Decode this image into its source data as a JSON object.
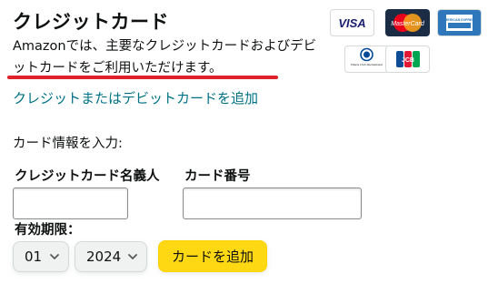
{
  "section": {
    "title": "クレジットカード",
    "description": "Amazonでは、主要なクレジットカードおよびデビットカードをご利用いただけます。",
    "add_link": "クレジットまたはデビットカードを追加"
  },
  "card_logos": [
    {
      "name": "VISA",
      "label": "VISA"
    },
    {
      "name": "MasterCard",
      "label": "MasterCard"
    },
    {
      "name": "American Express",
      "label": "AMERICAN EXPRESS"
    },
    {
      "name": "Diners Club International",
      "label": "Diners Club International"
    },
    {
      "name": "JCB",
      "label": "JCB"
    }
  ],
  "form": {
    "enter_label": "カード情報を入力:",
    "name_label": "クレジットカード名義人",
    "number_label": "カード番号",
    "expiry_label": "有効期限：",
    "name_value": "",
    "number_value": "",
    "month_value": "01",
    "year_value": "2024",
    "submit_label": "カードを追加"
  },
  "colors": {
    "link": "#007185",
    "button": "#ffd814",
    "underline": "#e0202a"
  }
}
